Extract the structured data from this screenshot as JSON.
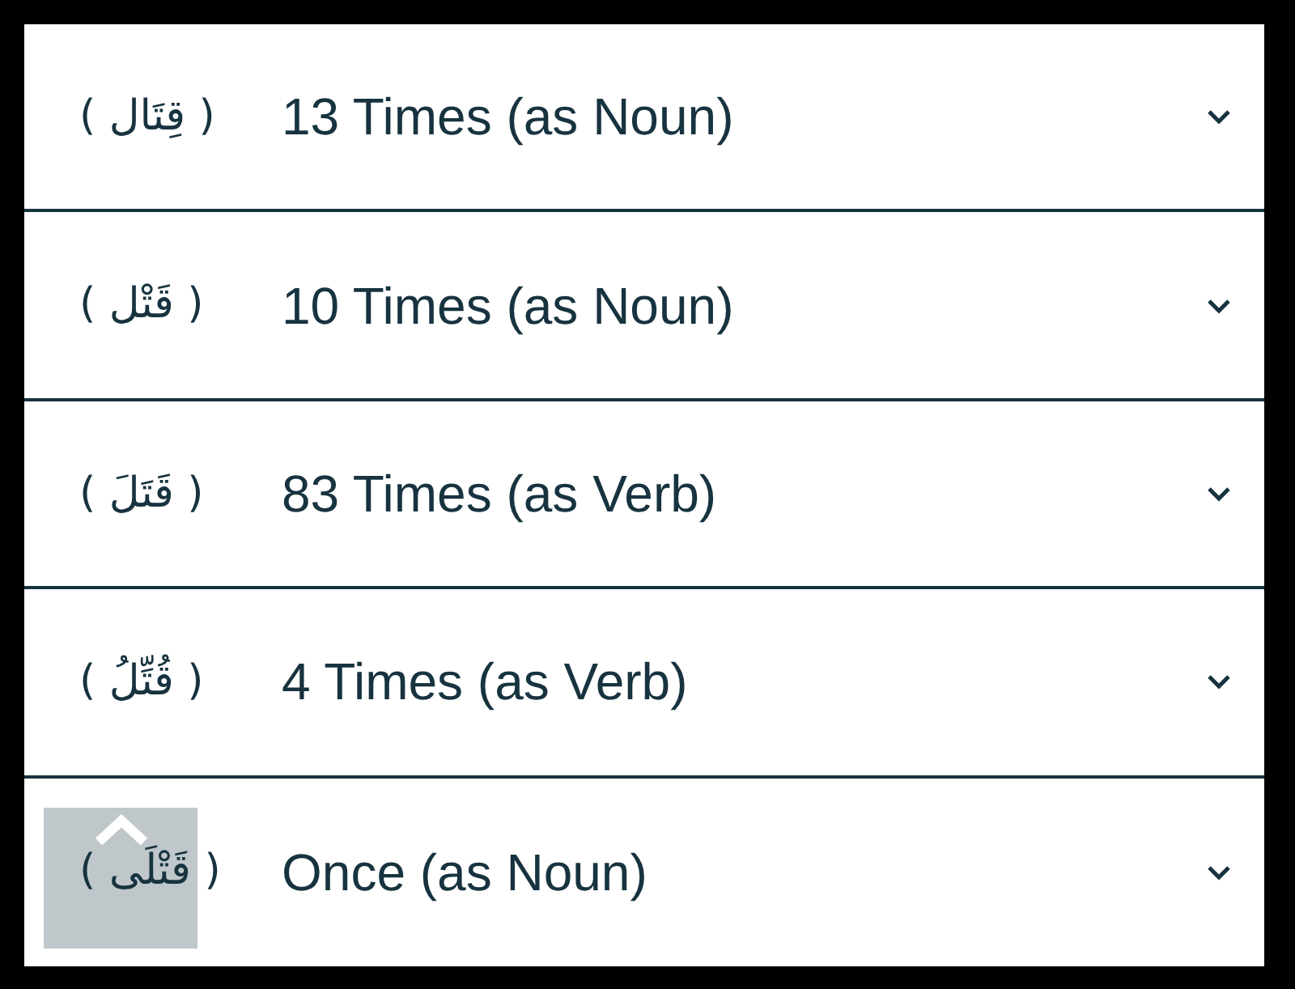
{
  "rows": [
    {
      "arabic": "( قِتَال )",
      "label": "13 Times (as Noun)",
      "expanded": false
    },
    {
      "arabic": "( قَتْل )",
      "label": "10 Times (as Noun)",
      "expanded": false
    },
    {
      "arabic": "( قَتَلَ )",
      "label": "83 Times (as Verb)",
      "expanded": false
    },
    {
      "arabic": "( قُتِّلُ )",
      "label": "4 Times (as Verb)",
      "expanded": false
    },
    {
      "arabic": "( قَتْلَى )",
      "label": "Once (as Noun)",
      "expanded": false
    }
  ]
}
